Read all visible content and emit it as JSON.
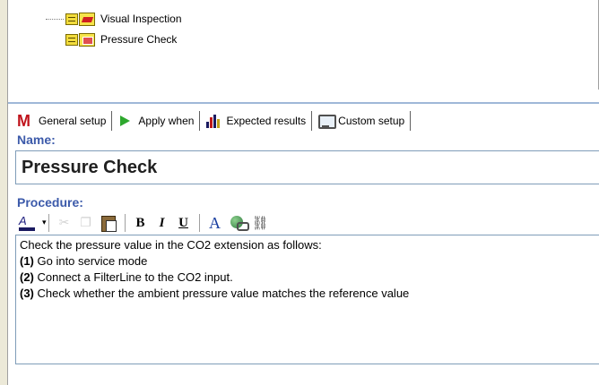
{
  "tree": {
    "items": [
      {
        "label": "Visual Inspection",
        "icon": "visual-inspection-icon"
      },
      {
        "label": "Pressure Check",
        "icon": "pressure-check-icon"
      }
    ]
  },
  "tabs": [
    {
      "label": "General setup",
      "icon": "m-logo-icon"
    },
    {
      "label": "Apply when",
      "icon": "play-arrow-icon"
    },
    {
      "label": "Expected results",
      "icon": "bar-chart-icon"
    },
    {
      "label": "Custom setup",
      "icon": "monitor-icon"
    }
  ],
  "form": {
    "name_label": "Name:",
    "name_value": "Pressure Check",
    "procedure_label": "Procedure:"
  },
  "toolbar": {
    "bold_label": "B",
    "italic_label": "I",
    "underline_label": "U",
    "font_label": "A",
    "font_color_caret": "▾"
  },
  "procedure": {
    "intro": "Check the pressure value in the CO2 extension as follows:",
    "steps": [
      {
        "num": "(1)",
        "text": " Go into service mode"
      },
      {
        "num": "(2)",
        "text": " Connect a FilterLine to the CO2 input."
      },
      {
        "num": "(3)",
        "text": " Check whether the ambient pressure value matches the reference value"
      }
    ]
  },
  "colors": {
    "label_blue": "#3C5AAA",
    "tab_bar_border": "#9FB8D8",
    "background": "#ECE9D8"
  }
}
